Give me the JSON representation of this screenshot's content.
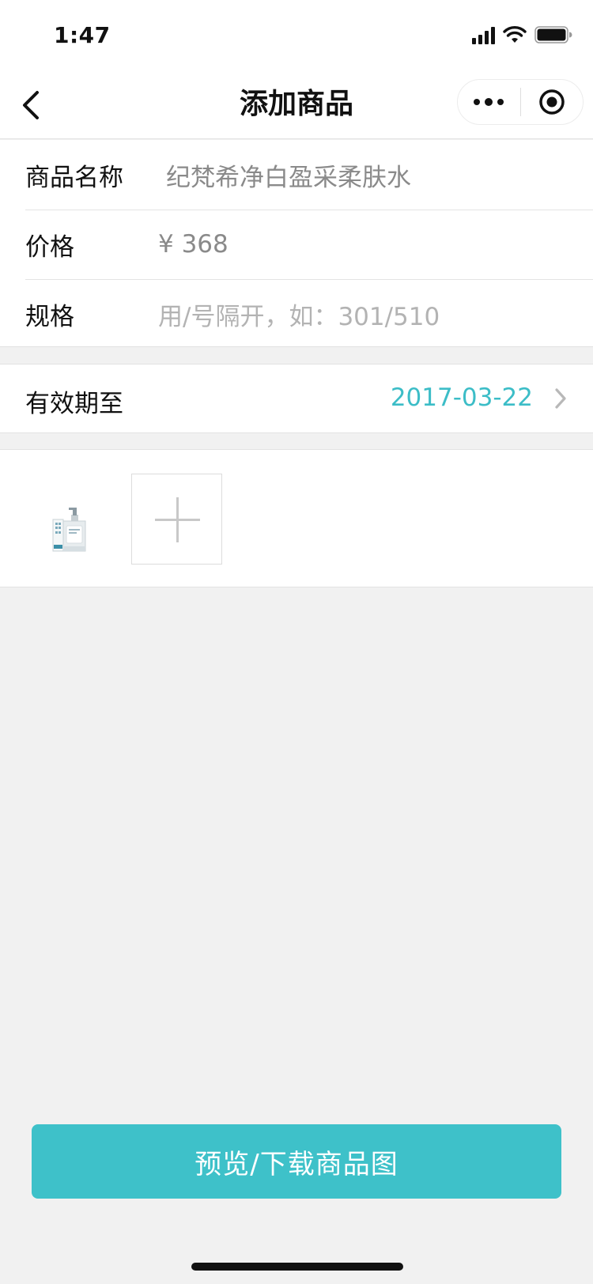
{
  "status_bar": {
    "time": "1:47"
  },
  "nav": {
    "title": "添加商品"
  },
  "form": {
    "name": {
      "label": "商品名称",
      "value": "纪梵希净白盈采柔肤水"
    },
    "price": {
      "label": "价格",
      "value": "¥ 368"
    },
    "spec": {
      "label": "规格",
      "placeholder": "用/号隔开，如：301/510"
    }
  },
  "expiry": {
    "label": "有效期至",
    "value": "2017-03-22"
  },
  "images": {
    "items": [
      "product-thumbnail"
    ]
  },
  "actions": {
    "preview_download_label": "预览/下载商品图"
  },
  "colors": {
    "accent": "#3ec1c9",
    "date_text": "#3cbdc7",
    "background": "#f1f1f1"
  }
}
